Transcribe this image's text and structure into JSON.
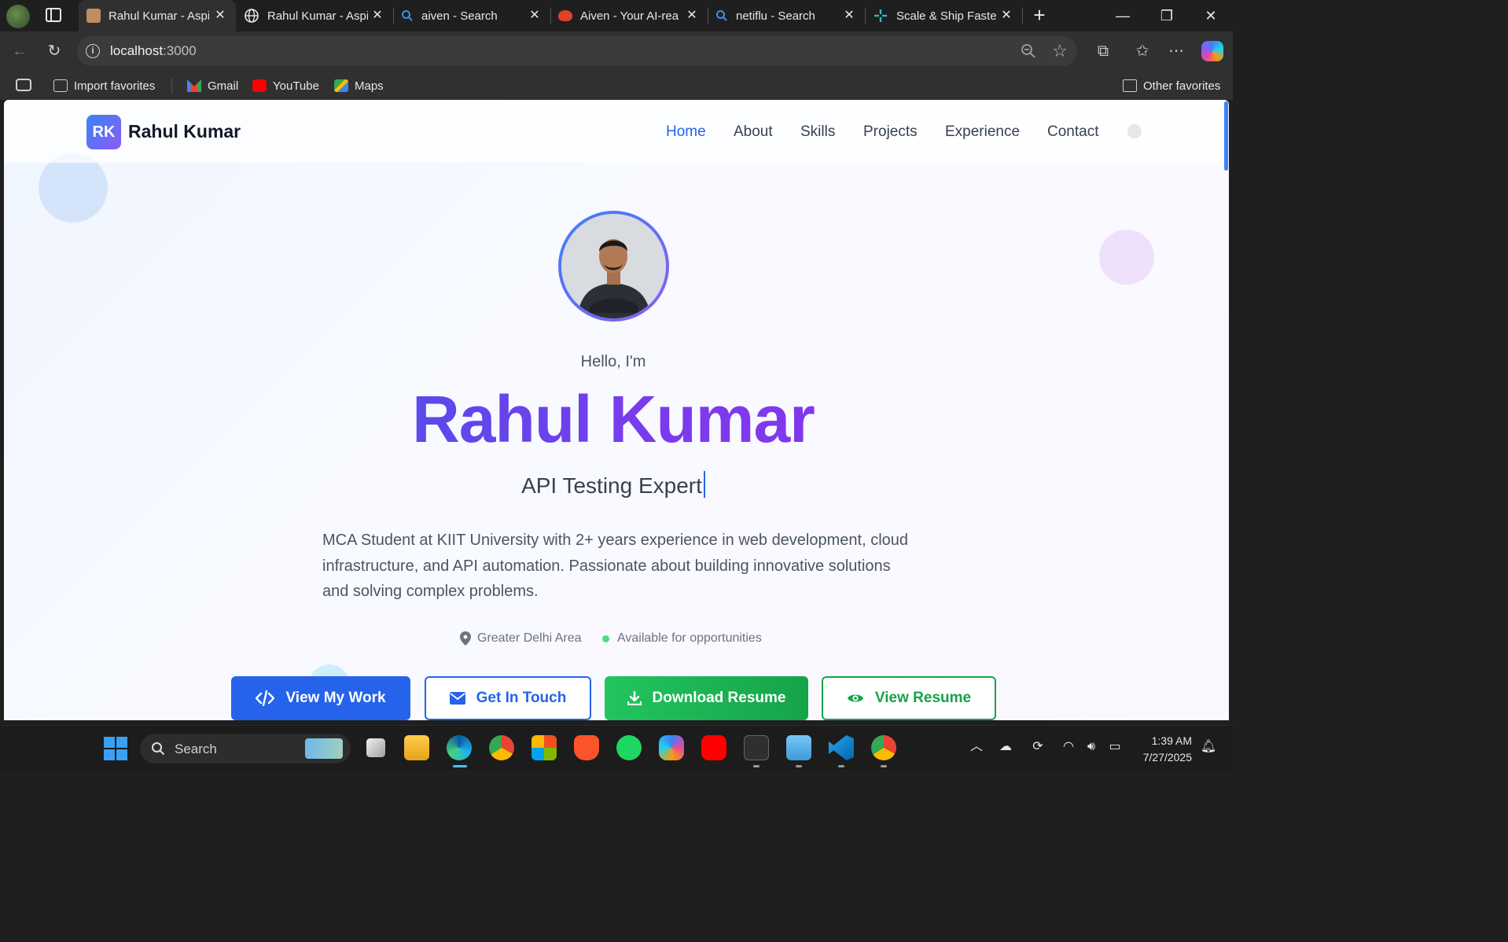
{
  "browser": {
    "tabs": [
      {
        "title": "Rahul Kumar - Aspi",
        "active": true
      },
      {
        "title": "Rahul Kumar - Aspi",
        "active": false
      },
      {
        "title": "aiven - Search",
        "active": false
      },
      {
        "title": "Aiven - Your AI-rea",
        "active": false
      },
      {
        "title": "netiflu - Search",
        "active": false
      },
      {
        "title": "Scale & Ship Faster",
        "active": false
      }
    ],
    "address": {
      "host": "localhost",
      "port": ":3000"
    },
    "favorites": [
      "Import favorites",
      "Gmail",
      "YouTube",
      "Maps"
    ],
    "other_favorites": "Other favorites"
  },
  "site": {
    "logo_initials": "RK",
    "logo_name": "Rahul Kumar",
    "nav": [
      "Home",
      "About",
      "Skills",
      "Projects",
      "Experience",
      "Contact"
    ],
    "active_nav": "Home",
    "hello": "Hello, I'm",
    "name": "Rahul Kumar",
    "role": "API Testing Expert",
    "bio": "MCA Student at KIIT University with 2+ years experience in web development, cloud infrastructure, and API automation. Passionate about building innovative solutions and solving complex problems.",
    "location": "Greater Delhi Area",
    "availability": "Available for opportunities",
    "buttons": {
      "view_work": "View My Work",
      "get_in_touch": "Get In Touch",
      "download_resume": "Download Resume",
      "view_resume": "View Resume"
    },
    "colors": {
      "primary": "#2563eb",
      "accent": "#8b5cf6",
      "success": "#16a34a"
    }
  },
  "taskbar": {
    "search_label": "Search",
    "time": "1:39 AM",
    "date": "7/27/2025"
  }
}
